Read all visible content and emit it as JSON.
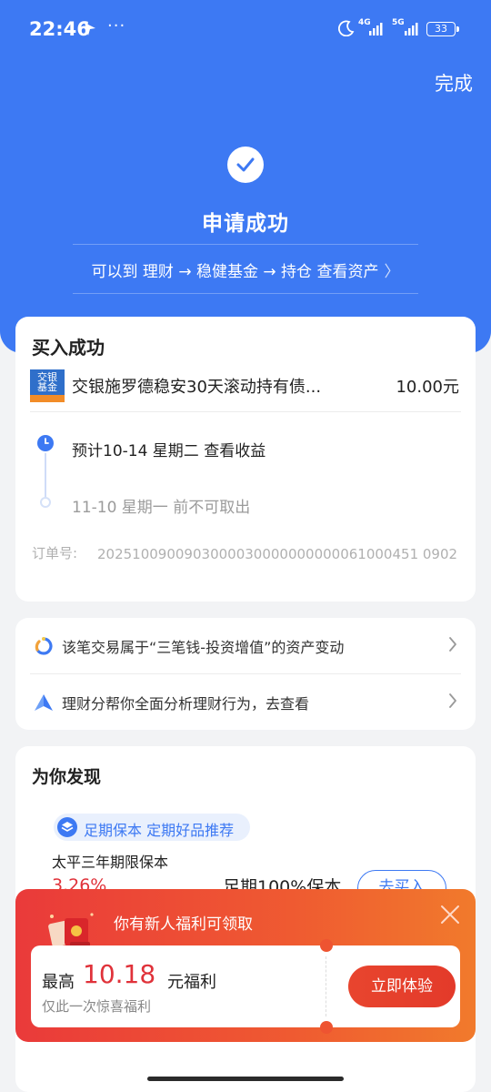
{
  "status_bar": {
    "time": "22:46",
    "more": "···",
    "net1": "4G",
    "net2": "5G",
    "battery": "33"
  },
  "header": {
    "done_label": "完成",
    "title": "申请成功",
    "path_text": "可以到 理财 → 稳健基金 → 持仓 查看资产"
  },
  "purchase": {
    "title": "买入成功",
    "fund_logo_text": "交银基金",
    "fund_name": "交银施罗德稳安30天滚动持有债...",
    "amount": "10.00元",
    "timeline": [
      {
        "label": "预计10-14 星期二 查看收益"
      },
      {
        "label": "11-10 星期一 前不可取出"
      }
    ],
    "order_label": "订单号:",
    "order_number": "2025100900903000030000000000061000451 0902"
  },
  "links": [
    {
      "label": "该笔交易属于“三笔钱-投资增值”的资产变动",
      "icon": "asset-ring-icon"
    },
    {
      "label": "理财分帮你全面分析理财行为，去查看",
      "icon": "triangle-logo-icon"
    }
  ],
  "discover": {
    "title": "为你发现",
    "tag": "足期保本 定期好品推荐",
    "product_name": "太平三年期限保本",
    "rate": "3.26%",
    "feature": "足期100%保本",
    "buy_label": "去买入"
  },
  "promo": {
    "title": "你有新人福利可领取",
    "prefix": "最高",
    "amount": "10.18",
    "suffix": "元福利",
    "subtitle": "仅此一次惊喜福利",
    "cta": "立即体验"
  }
}
